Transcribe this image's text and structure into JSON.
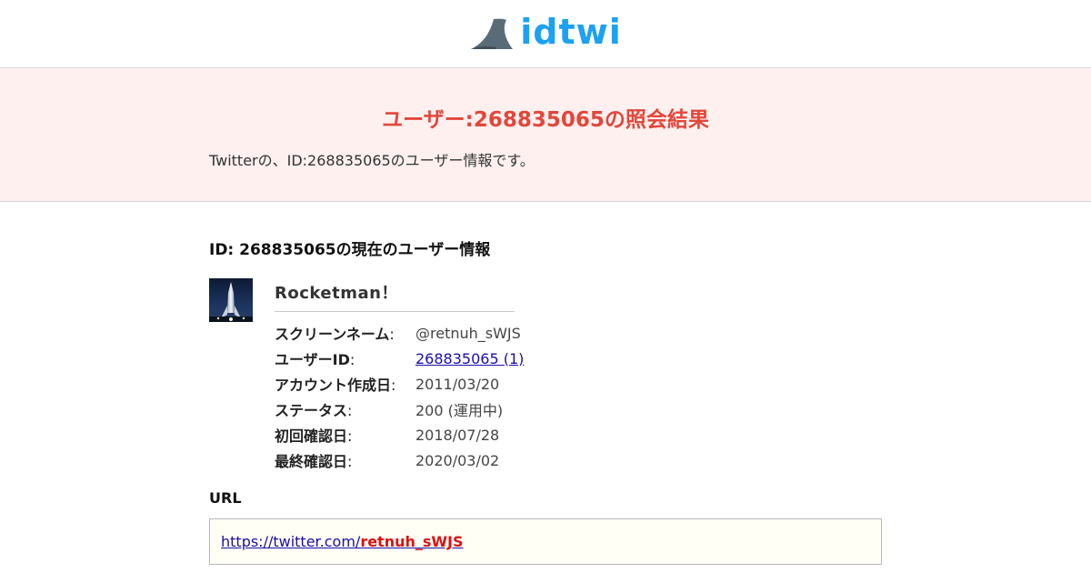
{
  "header": {
    "logo_text": "idtwi",
    "logo_icon": "shark-fin-icon",
    "colors": {
      "logo_text": "#1da1f2",
      "fin": "#5a6b78"
    }
  },
  "banner": {
    "title": "ユーザー:268835065の照会結果",
    "description": "Twitterの、ID:268835065のユーザー情報です。",
    "colors": {
      "background": "#fdf0ef",
      "title": "#e2473b"
    }
  },
  "user_section": {
    "heading": "ID: 268835065の現在のユーザー情報",
    "avatar_icon": "rocket-avatar-icon",
    "name": "Rocketman！",
    "fields": [
      {
        "label": "スクリーンネーム",
        "suffix": ":",
        "value": "@retnuh_sWJS",
        "is_link": false
      },
      {
        "label": "ユーザーID",
        "suffix": ":",
        "value": "268835065 (1)",
        "is_link": true
      },
      {
        "label": "アカウント作成日",
        "suffix": ":",
        "value": "2011/03/20",
        "is_link": false
      },
      {
        "label": "ステータス",
        "suffix": ":",
        "value": "200 (運用中)",
        "is_link": false
      },
      {
        "label": "初回確認日",
        "suffix": ":",
        "value": "2018/07/28",
        "is_link": false
      },
      {
        "label": "最終確認日",
        "suffix": ":",
        "value": "2020/03/02",
        "is_link": false
      }
    ]
  },
  "url_section": {
    "heading": "URL",
    "url_prefix": "https://twitter.com/",
    "url_handle": "retnuh_sWJS",
    "colors": {
      "link": "#1a0dab",
      "handle": "#dd1111",
      "box_background": "#fffff6"
    }
  }
}
